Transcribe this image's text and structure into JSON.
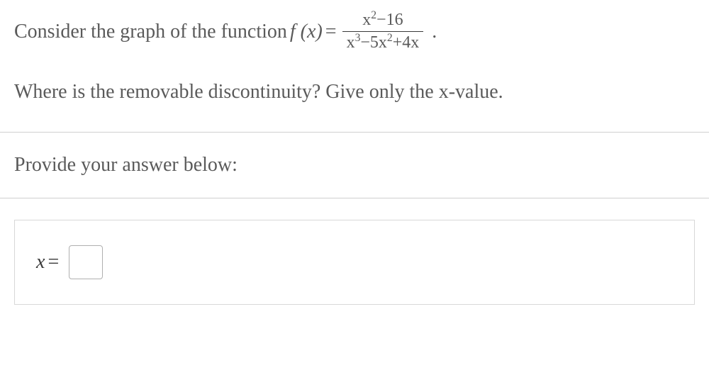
{
  "question": {
    "intro": "Consider the graph of the function ",
    "fx": "f (x)",
    "equals": " = ",
    "fraction": {
      "numerator_html": "x<sup>2</sup>−16",
      "denominator_html": "x<sup>3</sup>−5x<sup>2</sup>+4x"
    },
    "period": ".",
    "prompt": "Where is the removable discontinuity? Give only the x-value."
  },
  "answer_section": {
    "label": "Provide your answer below:",
    "variable": "x",
    "equals": "=",
    "input_value": ""
  },
  "chart_data": {
    "type": "table",
    "title": "Math problem: removable discontinuity",
    "function": "f(x) = (x^2 - 16) / (x^3 - 5x^2 + 4x)",
    "answer_field": "x"
  }
}
